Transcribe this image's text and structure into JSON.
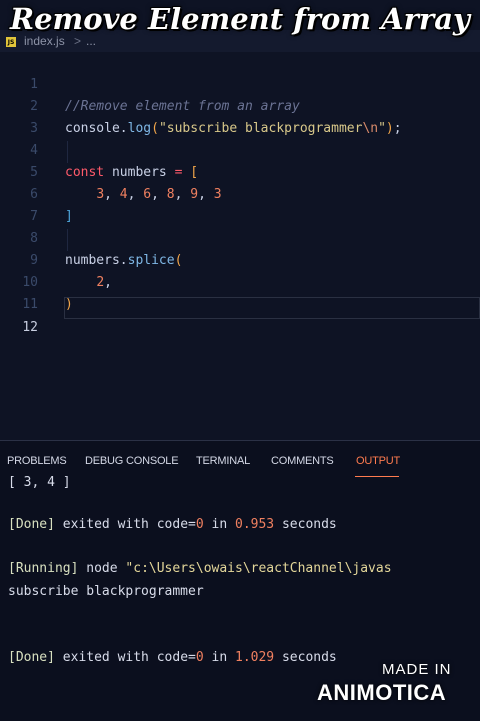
{
  "overlay": {
    "title": "Remove Element from Array"
  },
  "tab": {
    "icon": "js-file-icon",
    "icon_text": "JS",
    "filename": "index.js",
    "separator": ">",
    "crumb": "..."
  },
  "editor": {
    "lines": [
      {
        "n": "1",
        "code": "//Remove element from an array"
      },
      {
        "n": "2",
        "code": "console.log(\"subscribe blackprogrammer\\n\");"
      },
      {
        "n": "3",
        "code": ""
      },
      {
        "n": "4",
        "code": "const numbers = ["
      },
      {
        "n": "5",
        "code": "    3, 4, 6, 8, 9, 3"
      },
      {
        "n": "6",
        "code": "]"
      },
      {
        "n": "7",
        "code": ""
      },
      {
        "n": "8",
        "code": "numbers.splice("
      },
      {
        "n": "9",
        "code": "    2,"
      },
      {
        "n": "10",
        "code": ")"
      },
      {
        "n": "11",
        "code": ""
      },
      {
        "n": "12",
        "code": ""
      }
    ],
    "active_line": "12"
  },
  "panel": {
    "tabs": [
      "PROBLEMS",
      "DEBUG CONSOLE",
      "TERMINAL",
      "COMMENTS",
      "OUTPUT"
    ],
    "active_tab": "OUTPUT",
    "output": {
      "partial": "[ 3, 4 ]",
      "done1": {
        "tag": "[Done]",
        "text": " exited with code=",
        "code": "0",
        "in": " in ",
        "time": "0.953",
        "unit": " seconds"
      },
      "running": {
        "tag": "[Running]",
        "text": " node ",
        "path": "\"c:\\Users\\owais\\reactChannel\\javas"
      },
      "stdout": "subscribe blackprogrammer",
      "done2": {
        "tag": "[Done]",
        "text": " exited with code=",
        "code": "0",
        "in": " in ",
        "time": "1.029",
        "unit": " seconds"
      }
    }
  },
  "watermark": {
    "made_in": "MADE IN",
    "brand": "ANIMOTICA"
  }
}
